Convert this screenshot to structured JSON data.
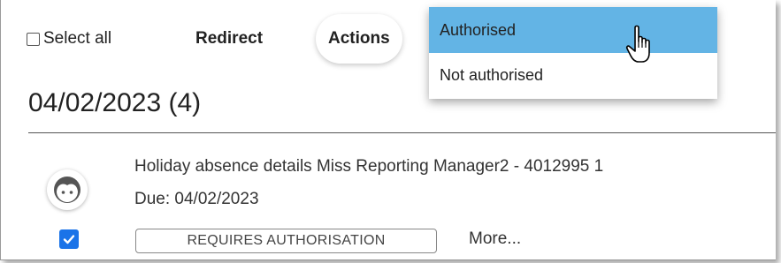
{
  "toolbar": {
    "select_all_label": "Select all",
    "redirect_label": "Redirect",
    "actions_label": "Actions"
  },
  "dropdown": {
    "options": [
      {
        "label": "Authorised",
        "highlighted": true
      },
      {
        "label": "Not authorised",
        "highlighted": false
      }
    ],
    "highlight_color": "#63b4e5"
  },
  "group": {
    "date_heading": "04/02/2023 (4)"
  },
  "item": {
    "title": "Holiday absence details Miss Reporting Manager2 - 4012995 1",
    "due": "Due: 04/02/2023",
    "checked": true,
    "status_badge": "REQUIRES AUTHORISATION",
    "more_label": "More..."
  },
  "colors": {
    "checkbox_checked": "#1a73e8"
  }
}
